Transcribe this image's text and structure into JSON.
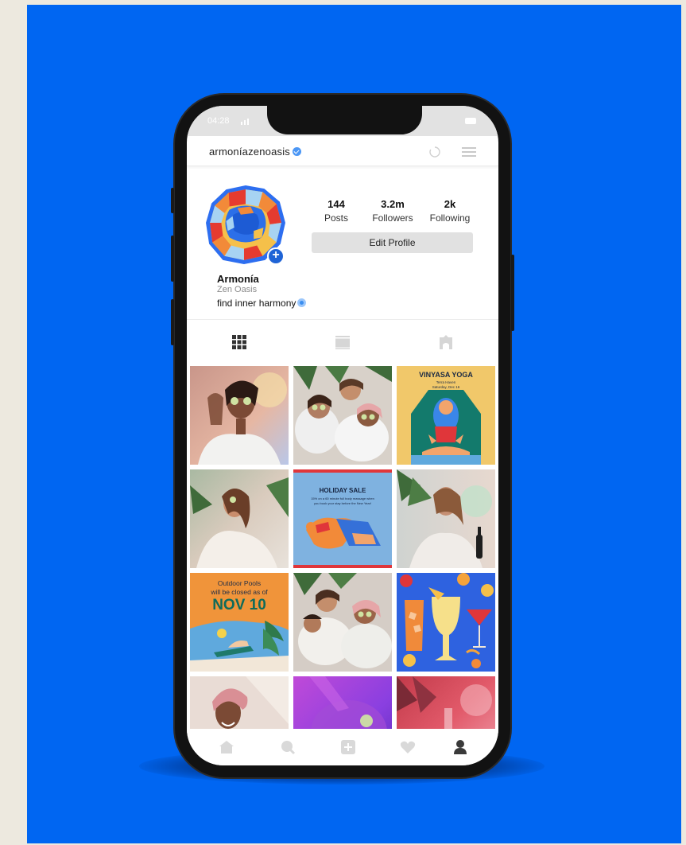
{
  "status": {
    "time": "04:28"
  },
  "profile": {
    "username": "armoníazenoasis",
    "name": "Armonía",
    "subtitle": "Zen Oasis",
    "bio": "find inner harmony",
    "edit_label": "Edit Profile"
  },
  "stats": [
    {
      "value": "144",
      "label": "Posts"
    },
    {
      "value": "3.2m",
      "label": "Followers"
    },
    {
      "value": "2k",
      "label": "Following"
    }
  ],
  "posts": {
    "yoga": {
      "title": "VINYASA YOGA",
      "line1": "Terra Haven",
      "line2": "Saturday, Dec 16"
    },
    "sale": {
      "title": "HOLIDAY SALE",
      "line1": "15% on a 60 minute full body massage when",
      "line2": "you book your stay before the New Year!"
    },
    "pools": {
      "line1": "Outdoor Pools",
      "line2": "will be closed as of",
      "date": "NOV 10"
    }
  },
  "colors": {
    "background": "#0066f2",
    "accent": "#1f64d6",
    "yoga_bg": "#f1c86a",
    "sale_bg": "#7fb2e0",
    "pools_bg": "#f0943a"
  }
}
